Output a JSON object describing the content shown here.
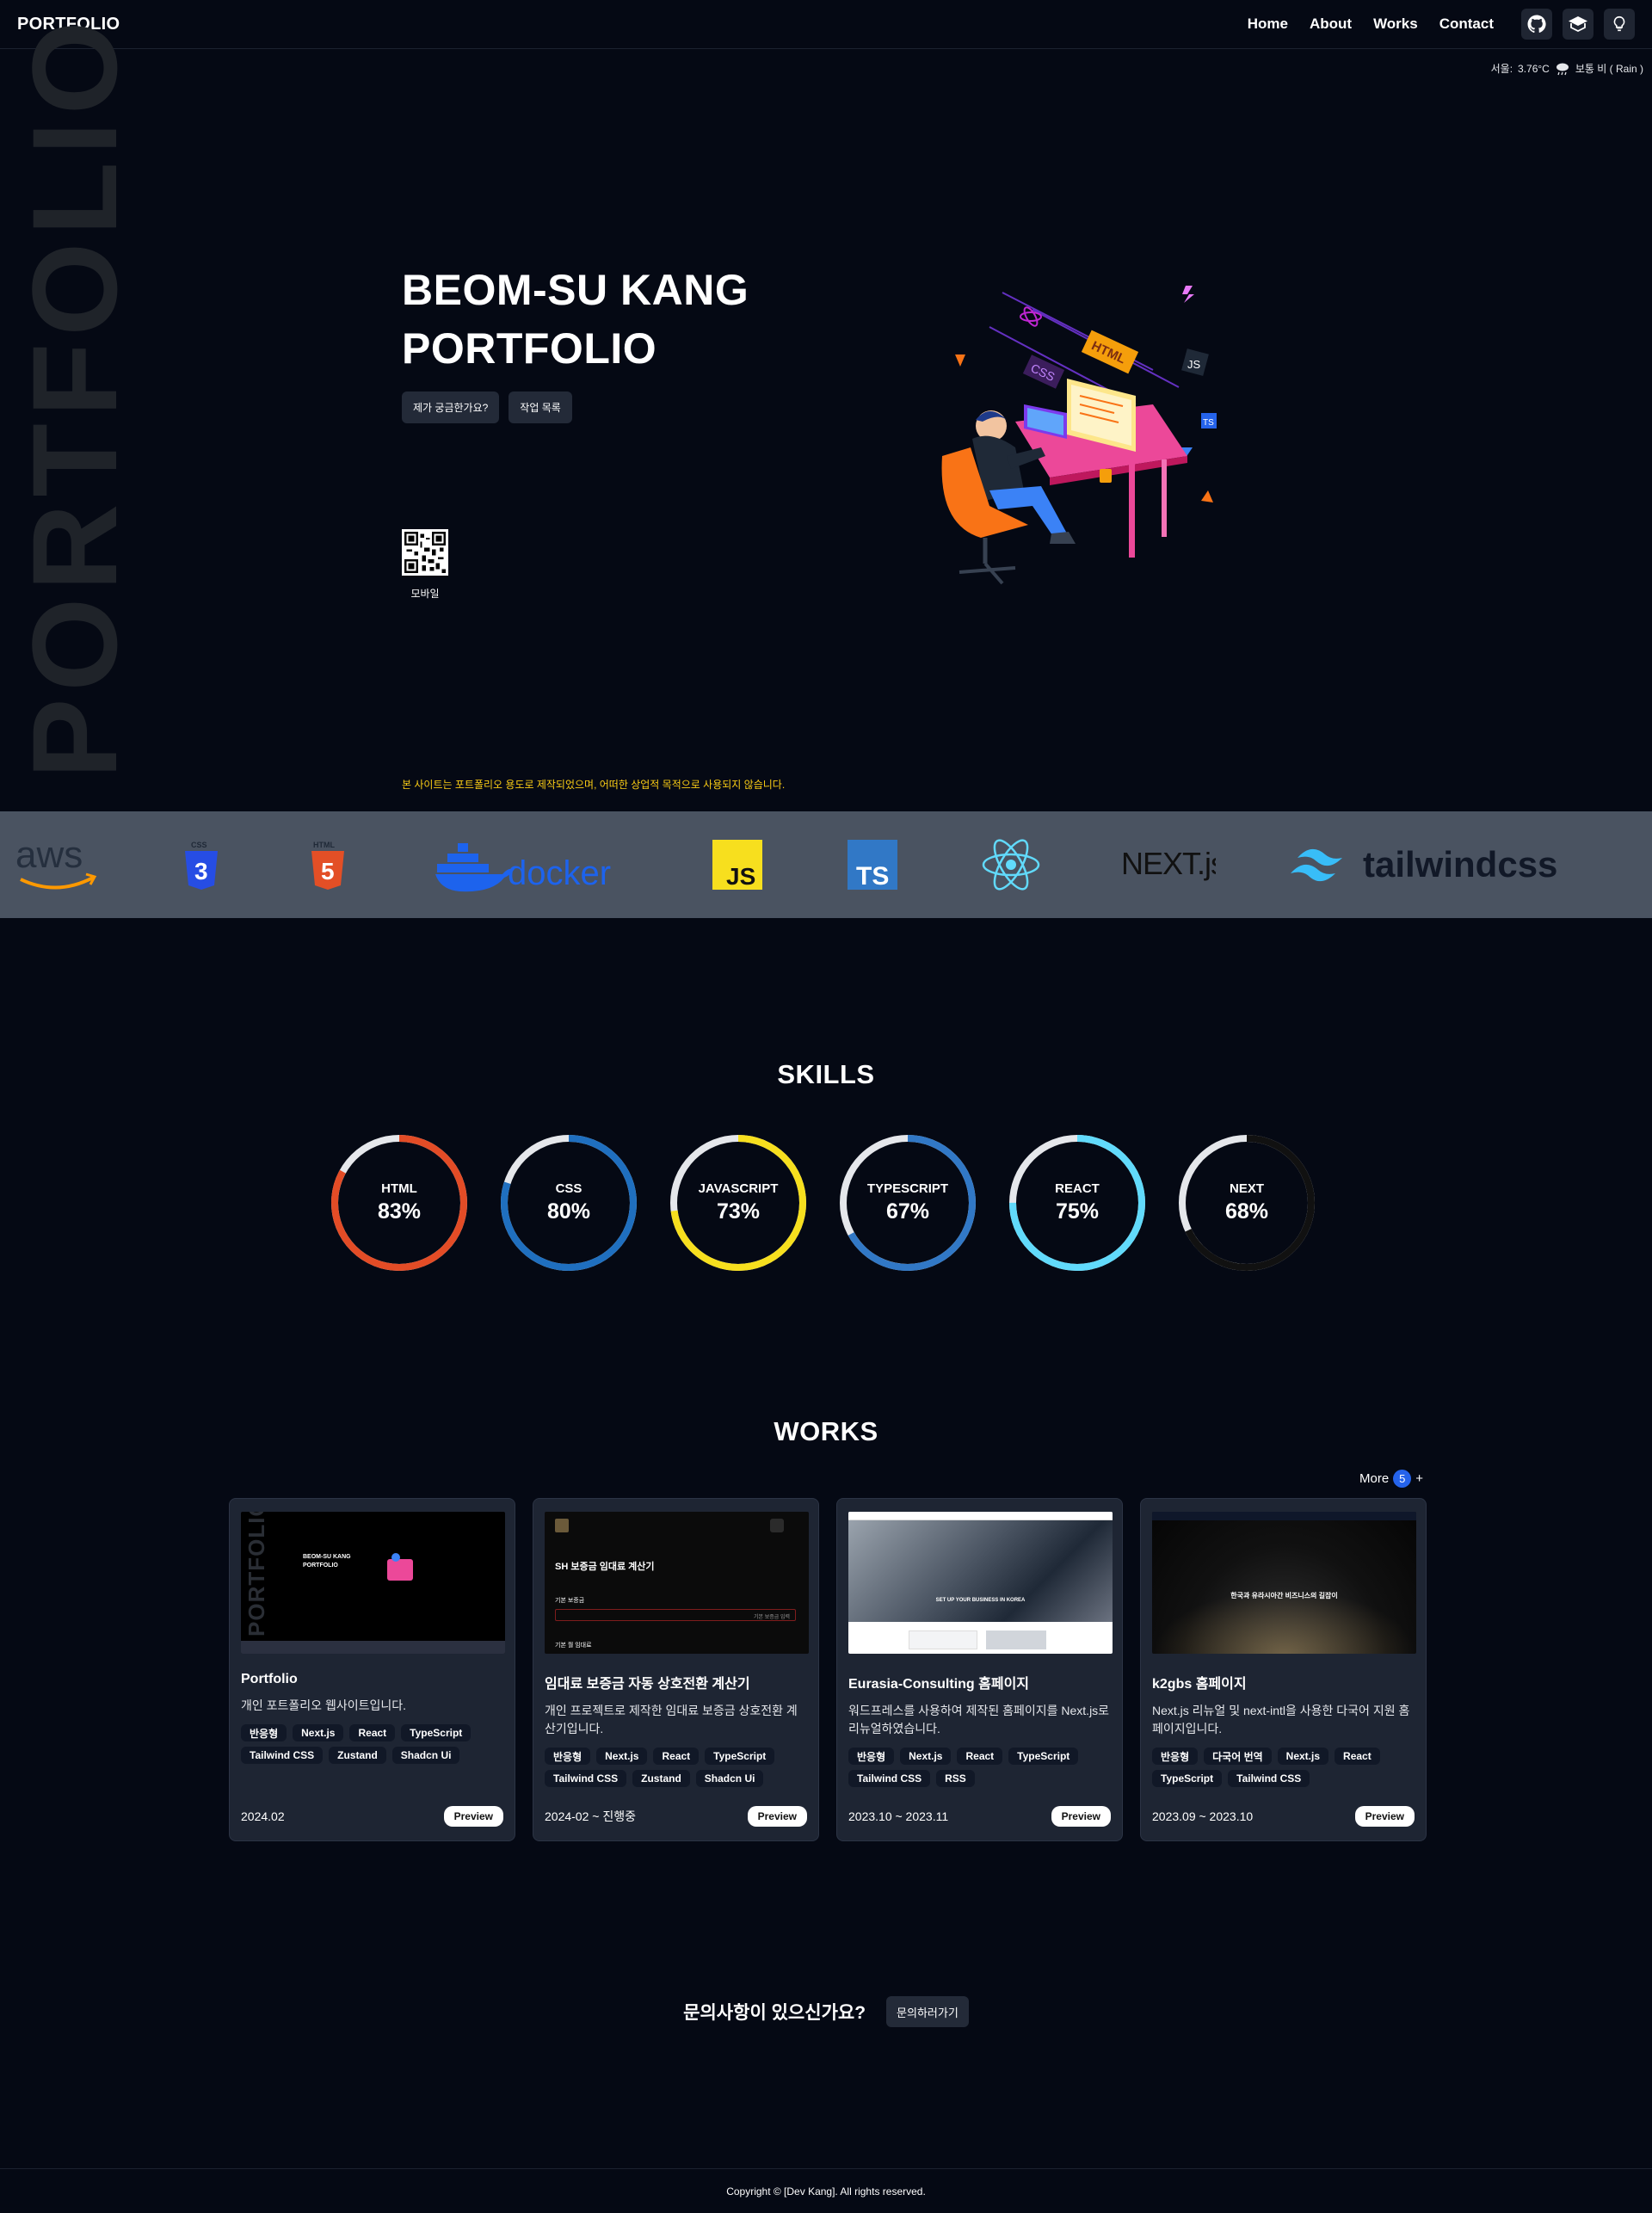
{
  "nav": {
    "brand": "PORTFOLIO",
    "links": [
      "Home",
      "About",
      "Works",
      "Contact"
    ],
    "icons": [
      "github-icon",
      "blog-icon",
      "theme-toggle-icon"
    ]
  },
  "weather": {
    "city": "서울:",
    "temp": "3.76°C",
    "desc": "보통 비 ( Rain )"
  },
  "hero": {
    "vertical_word": "PORTFOLIO",
    "title_line1": "BEOM-SU KANG",
    "title_line2": "PORTFOLIO",
    "btn_about": "제가 궁금한가요?",
    "btn_works": "작업 목록",
    "qr_label": "모바일",
    "notice": "본 사이트는 포트폴리오 용도로 제작되었으며, 어떠한 상업적 목적으로 사용되지 않습니다."
  },
  "tech_logos": [
    "aws",
    "CSS",
    "HTML",
    "docker",
    "JS",
    "TS",
    "React",
    "NEXT.js",
    "tailwindcss"
  ],
  "skills": {
    "title": "SKILLS",
    "items": [
      {
        "name": "HTML",
        "value": "83%",
        "pct": 83,
        "color": "#e34c26"
      },
      {
        "name": "CSS",
        "value": "80%",
        "pct": 80,
        "color": "#1f6fbf"
      },
      {
        "name": "JAVASCRIPT",
        "value": "73%",
        "pct": 73,
        "color": "#f7df1e"
      },
      {
        "name": "TYPESCRIPT",
        "value": "67%",
        "pct": 67,
        "color": "#3178c6"
      },
      {
        "name": "REACT",
        "value": "75%",
        "pct": 75,
        "color": "#61dafb"
      },
      {
        "name": "NEXT",
        "value": "68%",
        "pct": 68,
        "color": "#111111"
      }
    ]
  },
  "works": {
    "title": "WORKS",
    "more_label": "More",
    "more_count": "5",
    "more_plus": "+",
    "preview_label": "Preview",
    "cards": [
      {
        "title": "Portfolio",
        "desc": "개인 포트폴리오 웹사이트입니다.",
        "tags": [
          "반응형",
          "Next.js",
          "React",
          "TypeScript",
          "Tailwind CSS",
          "Zustand",
          "Shadcn Ui"
        ],
        "date": "2024.02"
      },
      {
        "title": "임대료 보증금 자동 상호전환 계산기",
        "desc": "개인 프로젝트로 제작한 임대료 보증금 상호전환 계산기입니다.",
        "tags": [
          "반응형",
          "Next.js",
          "React",
          "TypeScript",
          "Tailwind CSS",
          "Zustand",
          "Shadcn Ui"
        ],
        "date": "2024-02 ~ 진행중"
      },
      {
        "title": "Eurasia-Consulting 홈페이지",
        "desc": "워드프레스를 사용하여 제작된 홈페이지를 Next.js로 리뉴얼하였습니다.",
        "tags": [
          "반응형",
          "Next.js",
          "React",
          "TypeScript",
          "Tailwind CSS",
          "RSS"
        ],
        "date": "2023.10 ~ 2023.11"
      },
      {
        "title": "k2gbs 홈페이지",
        "desc": "Next.js 리뉴얼 및 next-intl을 사용한 다국어 지원 홈페이지입니다.",
        "tags": [
          "반응형",
          "다국어 번역",
          "Next.js",
          "React",
          "TypeScript",
          "Tailwind CSS"
        ],
        "date": "2023.09 ~ 2023.10"
      }
    ],
    "shot1": {
      "title1": "BEOM-SU KANG",
      "title2": "PORTFOLIO",
      "side": "PORTFOLIO"
    },
    "shot2": {
      "title": "SH 보증금 임대료 계산기",
      "field1": "기본 보증금",
      "placeholder": "기본 보증금 입력",
      "field2": "기본 월 임대료"
    },
    "shot3": {
      "banner": "SET UP YOUR BUSINESS IN KOREA"
    },
    "shot4": {
      "banner": "한국과 유라시아간 비즈니스의 길잡이"
    }
  },
  "contact": {
    "text": "문의사항이 있으신가요?",
    "button": "문의하러가기"
  },
  "footer": {
    "copyright": "Copyright © [Dev Kang]. All rights reserved."
  }
}
